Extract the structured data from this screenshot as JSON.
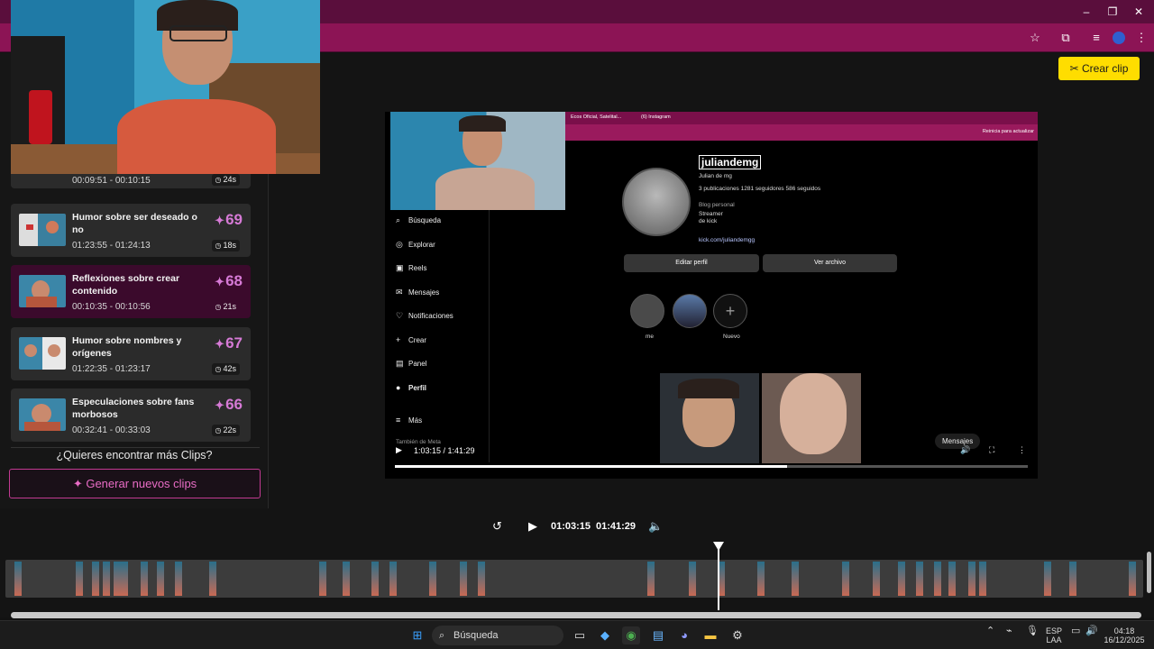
{
  "window": {
    "minimize": "–",
    "restore": "❐",
    "close": "✕"
  },
  "toolbar_icons": [
    "star-icon",
    "extensions-icon",
    "media-icon",
    "profile-icon",
    "menu-icon"
  ],
  "crear_clip": {
    "icon": "✂",
    "label": "Crear clip"
  },
  "clips": [
    {
      "title": "",
      "time": "00:09:51 - 00:10:15",
      "score": "",
      "duration": "24s"
    },
    {
      "title": "Humor sobre ser deseado o no",
      "time": "01:23:55 - 01:24:13",
      "score": "69",
      "duration": "18s"
    },
    {
      "title": "Reflexiones sobre crear contenido",
      "time": "00:10:35 - 00:10:56",
      "score": "68",
      "duration": "21s"
    },
    {
      "title": "Humor sobre nombres y orígenes",
      "time": "01:22:35 - 01:23:17",
      "score": "67",
      "duration": "42s"
    },
    {
      "title": "Especulaciones sobre fans morbosos",
      "time": "00:32:41 - 00:33:03",
      "score": "66",
      "duration": "22s"
    }
  ],
  "more_clips_question": "¿Quieres encontrar más Clips?",
  "generate_button": "Generar nuevos clips",
  "preview": {
    "tab1": "Ecos Oficial, Satelital...",
    "tab2": "(6) Instagram",
    "address_action": "Reinicia para actualizar",
    "username": "juliandemg",
    "display_name": "Julian de mg",
    "stats": "3 publicaciones   1281 seguidores   586 seguidos",
    "bio_1": "Blog personal",
    "bio_2": "Streamer",
    "bio_3": "de kick",
    "link": "kick.com/juliandemgg",
    "edit_profile": "Editar perfil",
    "view_archive": "Ver archivo",
    "highlight_1": "me",
    "highlight_new": "Nuevo",
    "messages": "Mensajes",
    "also_meta": "También de Meta",
    "nav": [
      {
        "icon": "⌕",
        "label": "Búsqueda"
      },
      {
        "icon": "◎",
        "label": "Explorar"
      },
      {
        "icon": "▣",
        "label": "Reels"
      },
      {
        "icon": "✉",
        "label": "Mensajes"
      },
      {
        "icon": "♡",
        "label": "Notificaciones"
      },
      {
        "icon": "+",
        "label": "Crear"
      },
      {
        "icon": "▤",
        "label": "Panel"
      },
      {
        "icon": "●",
        "label": "Perfil"
      },
      {
        "icon": "≡",
        "label": "Más"
      }
    ],
    "time": "1:03:15 / 1:41:29",
    "progress": 0.62
  },
  "player": {
    "current": "01:03:15",
    "total": "01:41:29"
  },
  "taskbar": {
    "search": "Búsqueda",
    "lang_1": "ESP",
    "lang_2": "LAA",
    "clock_time": "04:18",
    "clock_date": "16/12/2025"
  }
}
